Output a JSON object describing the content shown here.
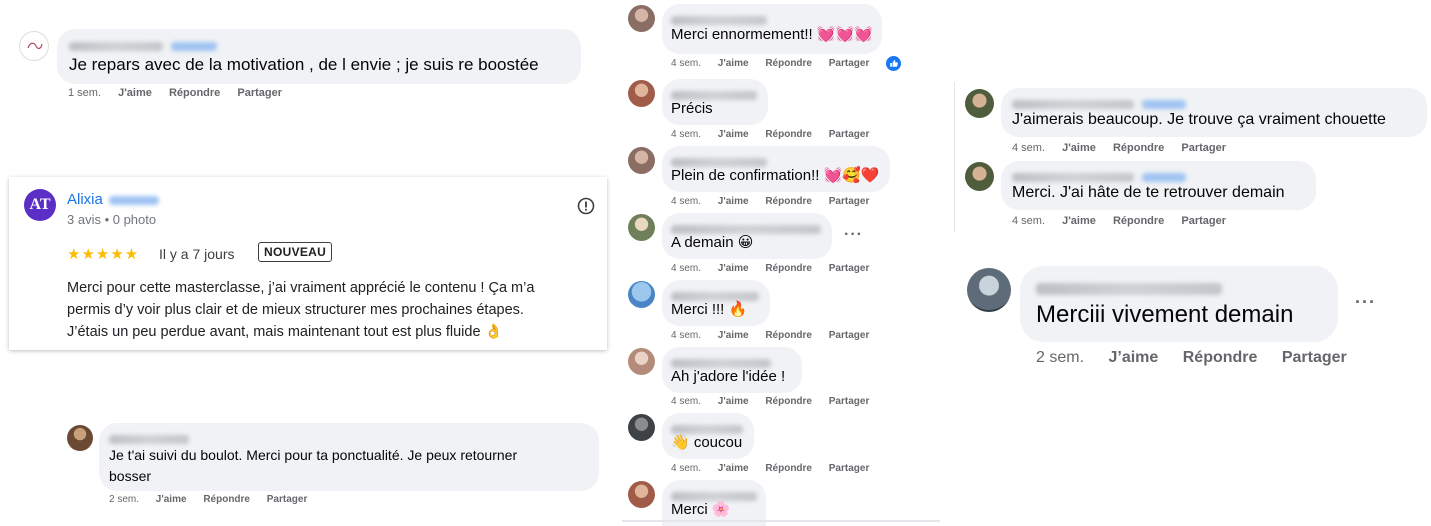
{
  "left_top": {
    "comment": "Je repars avec de la motivation , de l envie ; je suis re boostée",
    "time": "1 sem.",
    "like": "J'aime",
    "reply": "Répondre",
    "share": "Partager"
  },
  "review": {
    "name": "Alixia",
    "avatar_initials": "AT",
    "meta": "3 avis • 0 photo",
    "stars": "★★★★★",
    "date": "Il y a 7 jours",
    "badge": "NOUVEAU",
    "lines": [
      "Merci pour cette masterclasse, j’ai vraiment apprécié le contenu ! Ça m’a",
      "permis d’y voir plus clair et de mieux structurer mes prochaines étapes.",
      "J’étais un peu perdue avant, mais maintenant tout est plus fluide 👌"
    ]
  },
  "left_bottom": {
    "lines": [
      "Je t'ai suivi du boulot. Merci pour ta ponctualité. Je peux retourner",
      "bosser"
    ],
    "time": "2 sem.",
    "like": "J'aime",
    "reply": "Répondre",
    "share": "Partager"
  },
  "middle": {
    "comments": [
      {
        "text": "Merci ennormement!! 💓💓💓",
        "time": "4 sem."
      },
      {
        "text": "Précis",
        "time": "4 sem."
      },
      {
        "text": "Plein de confirmation!! 💓🥰❤️",
        "time": "4 sem."
      },
      {
        "text": "A demain 😀",
        "time": "4 sem."
      },
      {
        "text": "Merci !!! 🔥",
        "time": "4 sem."
      },
      {
        "text": "Ah j'adore l'idée !",
        "time": "4 sem."
      },
      {
        "text": "👋 coucou",
        "time": "4 sem."
      },
      {
        "text": "Merci 🌸"
      }
    ],
    "like": "J'aime",
    "reply": "Répondre",
    "share": "Partager"
  },
  "right_top": {
    "comments": [
      {
        "text": "J'aimerais beaucoup. Je trouve ça vraiment chouette",
        "time": "4 sem."
      },
      {
        "text": "Merci. J'ai hâte de te retrouver demain",
        "time": "4 sem."
      }
    ],
    "like": "J'aime",
    "reply": "Répondre",
    "share": "Partager"
  },
  "right_big": {
    "text": "Merciii vivement demain",
    "time": "2 sem.",
    "like": "J’aime",
    "reply": "Répondre",
    "share": "Partager",
    "more": "···"
  },
  "colors": {
    "bubble": "#f0f2f5",
    "link": "#1a73e8",
    "star": "#fbbc04",
    "fb_blue": "#1877f2"
  }
}
